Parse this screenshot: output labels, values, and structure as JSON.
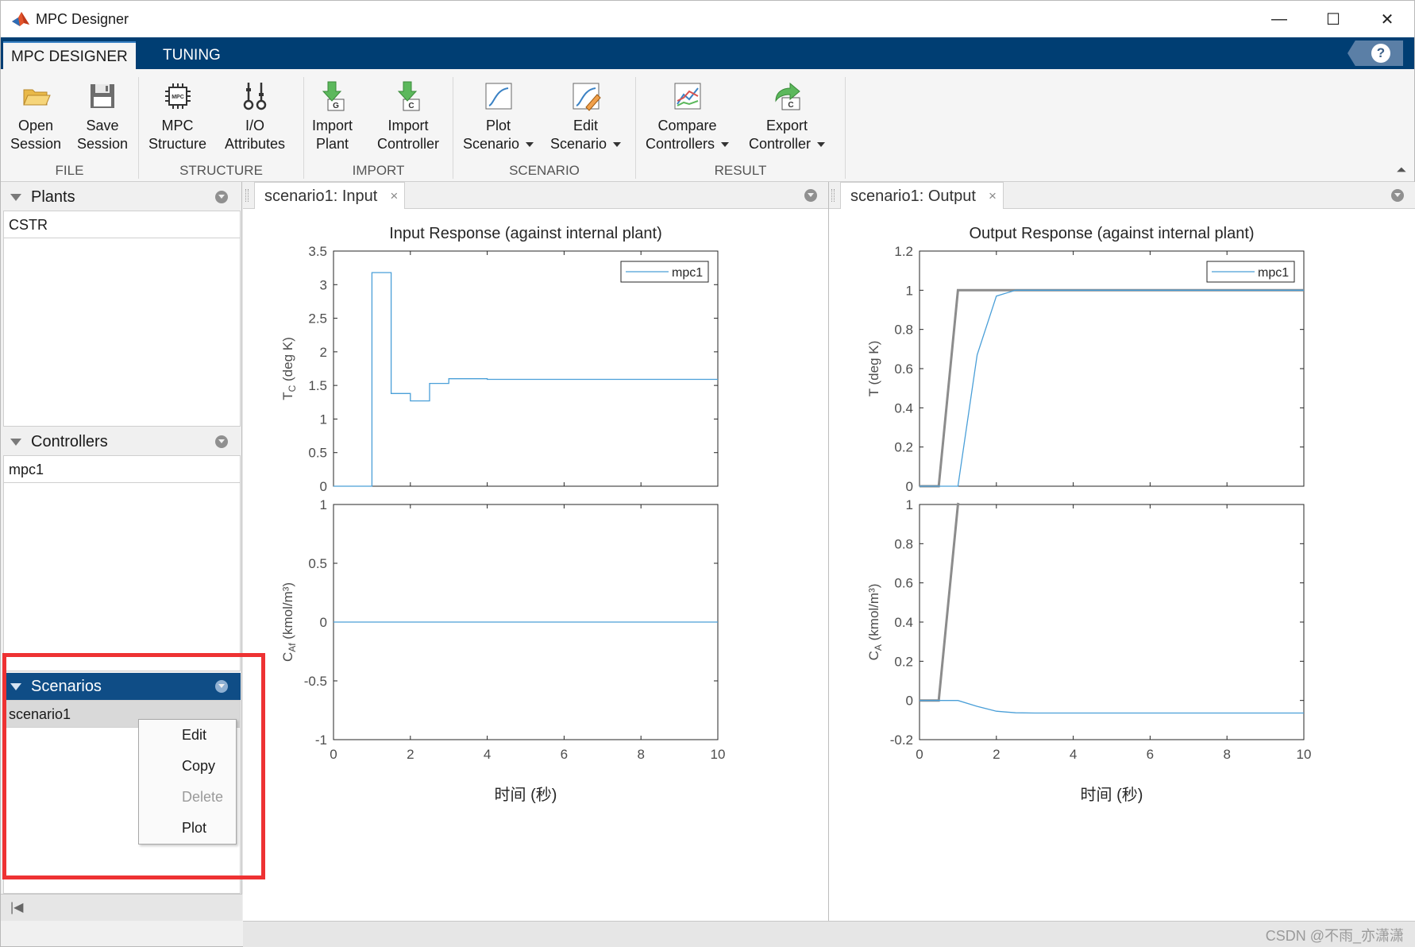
{
  "window": {
    "title": "MPC Designer",
    "minimize_glyph": "—",
    "maximize_glyph": "☐",
    "close_glyph": "✕"
  },
  "ribbon_tabs": [
    {
      "label": "MPC DESIGNER",
      "active": true
    },
    {
      "label": "TUNING",
      "active": false
    }
  ],
  "help_label": "?",
  "ribbon": {
    "groups": [
      {
        "label": "FILE",
        "buttons": [
          {
            "label": "Open\nSession",
            "icon": "folder-open-icon",
            "dropdown": false
          },
          {
            "label": "Save\nSession",
            "icon": "floppy-disk-icon",
            "dropdown": false
          }
        ]
      },
      {
        "label": "STRUCTURE",
        "buttons": [
          {
            "label": "MPC\nStructure",
            "icon": "mpc-chip-icon",
            "dropdown": false
          },
          {
            "label": "I/O\nAttributes",
            "icon": "io-attributes-icon",
            "dropdown": false
          }
        ]
      },
      {
        "label": "IMPORT",
        "buttons": [
          {
            "label": "Import\nPlant",
            "icon": "import-plant-icon",
            "dropdown": false
          },
          {
            "label": "Import\nController",
            "icon": "import-controller-icon",
            "dropdown": false
          }
        ]
      },
      {
        "label": "SCENARIO",
        "buttons": [
          {
            "label": "Plot\nScenario",
            "icon": "plot-scenario-icon",
            "dropdown": true
          },
          {
            "label": "Edit\nScenario",
            "icon": "edit-scenario-icon",
            "dropdown": true
          }
        ]
      },
      {
        "label": "RESULT",
        "buttons": [
          {
            "label": "Compare\nControllers",
            "icon": "compare-controllers-icon",
            "dropdown": true
          },
          {
            "label": "Export\nController",
            "icon": "export-controller-icon",
            "dropdown": true
          }
        ]
      }
    ]
  },
  "browser": {
    "plants": {
      "header": "Plants",
      "items": [
        "CSTR"
      ]
    },
    "controllers": {
      "header": "Controllers",
      "items": [
        "mpc1"
      ]
    },
    "scenarios": {
      "header": "Scenarios",
      "items": [
        "scenario1"
      ]
    }
  },
  "context_menu": {
    "items": [
      {
        "label": "Edit",
        "enabled": true
      },
      {
        "label": "Copy",
        "enabled": true
      },
      {
        "label": "Delete",
        "enabled": false
      },
      {
        "label": "Plot",
        "enabled": true
      }
    ]
  },
  "documents": [
    {
      "tab": "scenario1: Input",
      "close_glyph": "×"
    },
    {
      "tab": "scenario1: Output",
      "close_glyph": "×"
    }
  ],
  "watermark": "CSDN @不雨_亦潇潇",
  "colors": {
    "series_blue": "#4a9fd8",
    "reference_gray": "#8c8c8c",
    "ribbon_bar": "#003e73",
    "highlight_red": "#ee3233"
  },
  "chart_data": [
    {
      "type": "line",
      "panel": "input",
      "title": "Input Response (against internal plant)",
      "xlabel": "时间 (秒)",
      "subplots": [
        {
          "ylabel": "T_C (deg K)",
          "ylabel_main": "T",
          "ylabel_sub": "C",
          "ylabel_rest": " (deg K)",
          "ylim": [
            0,
            3.5
          ],
          "yticks": [
            "0",
            "0.5",
            "1",
            "1.5",
            "2",
            "2.5",
            "3",
            "3.5"
          ],
          "ytick_values": [
            0,
            0.5,
            1,
            1.5,
            2,
            2.5,
            3,
            3.5
          ],
          "legend": "mpc1",
          "series": [
            {
              "name": "mpc1",
              "color": "#4a9fd8",
              "step": true,
              "x": [
                0,
                1,
                1.5,
                2,
                2.5,
                3,
                4,
                10
              ],
              "y": [
                0,
                3.18,
                1.38,
                1.27,
                1.53,
                1.6,
                1.59,
                1.59
              ]
            }
          ]
        },
        {
          "ylabel": "C_Af (kmol/m³)",
          "ylabel_main": "C",
          "ylabel_sub": "Af",
          "ylabel_rest": " (kmol/m³)",
          "ylim": [
            -1,
            1
          ],
          "yticks": [
            "-1",
            "-0.5",
            "0",
            "0.5",
            "1"
          ],
          "ytick_values": [
            -1,
            -0.5,
            0,
            0.5,
            1
          ],
          "xlim": [
            0,
            10
          ],
          "xticks": [
            "0",
            "2",
            "4",
            "6",
            "8",
            "10"
          ],
          "xtick_values": [
            0,
            2,
            4,
            6,
            8,
            10
          ],
          "series": [
            {
              "name": "mpc1",
              "color": "#4a9fd8",
              "step": false,
              "x": [
                0,
                10
              ],
              "y": [
                0,
                0
              ]
            }
          ]
        }
      ]
    },
    {
      "type": "line",
      "panel": "output",
      "title": "Output Response (against internal plant)",
      "xlabel": "时间 (秒)",
      "subplots": [
        {
          "ylabel": "T (deg K)",
          "ylabel_main": "T (deg K)",
          "ylabel_sub": "",
          "ylabel_rest": "",
          "ylim": [
            0,
            1.2
          ],
          "yticks": [
            "0",
            "0.2",
            "0.4",
            "0.6",
            "0.8",
            "1",
            "1.2"
          ],
          "ytick_values": [
            0,
            0.2,
            0.4,
            0.6,
            0.8,
            1,
            1.2
          ],
          "legend": "mpc1",
          "series": [
            {
              "name": "reference",
              "color": "#8c8c8c",
              "width": 3,
              "step": false,
              "x": [
                0,
                0.5,
                1,
                10
              ],
              "y": [
                0,
                0,
                1,
                1
              ]
            },
            {
              "name": "mpc1",
              "color": "#4a9fd8",
              "step": false,
              "x": [
                0,
                1,
                1.5,
                2,
                2.5,
                3,
                10
              ],
              "y": [
                0,
                0,
                0.67,
                0.97,
                1.0,
                1.0,
                1.0
              ]
            }
          ]
        },
        {
          "ylabel": "C_A (kmol/m³)",
          "ylabel_main": "C",
          "ylabel_sub": "A",
          "ylabel_rest": " (kmol/m³)",
          "ylim": [
            -0.2,
            1
          ],
          "yticks": [
            "-0.2",
            "0",
            "0.2",
            "0.4",
            "0.6",
            "0.8",
            "1"
          ],
          "ytick_values": [
            -0.2,
            0,
            0.2,
            0.4,
            0.6,
            0.8,
            1
          ],
          "xlim": [
            0,
            10
          ],
          "xticks": [
            "0",
            "2",
            "4",
            "6",
            "8",
            "10"
          ],
          "xtick_values": [
            0,
            2,
            4,
            6,
            8,
            10
          ],
          "series": [
            {
              "name": "reference",
              "color": "#8c8c8c",
              "width": 3,
              "step": false,
              "x": [
                0,
                0.5,
                1,
                1.01
              ],
              "y": [
                0,
                0,
                1,
                1.05
              ]
            },
            {
              "name": "mpc1",
              "color": "#4a9fd8",
              "step": false,
              "x": [
                0,
                1,
                1.5,
                2,
                2.5,
                3,
                10
              ],
              "y": [
                0,
                0,
                -0.03,
                -0.055,
                -0.063,
                -0.064,
                -0.064
              ]
            }
          ]
        }
      ]
    }
  ]
}
